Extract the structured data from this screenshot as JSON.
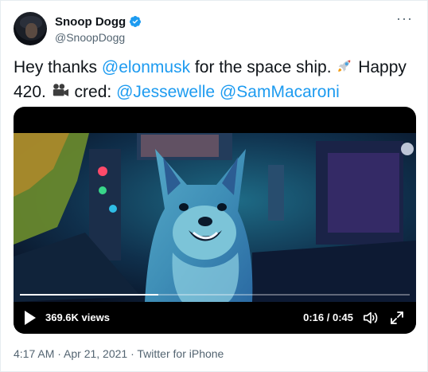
{
  "author": {
    "name": "Snoop Dogg",
    "handle": "@SnoopDogg",
    "verified": true,
    "avatar_icon": "profile-photo"
  },
  "more_icon": "ellipsis-icon",
  "tweet": {
    "segments": [
      {
        "type": "text",
        "value": "Hey thanks "
      },
      {
        "type": "mention",
        "value": "@elonmusk"
      },
      {
        "type": "text",
        "value": " for the space ship. "
      },
      {
        "type": "emoji",
        "value": "rocket-emoji"
      },
      {
        "type": "text",
        "value": " Happy 420. "
      },
      {
        "type": "emoji",
        "value": "movie-camera-emoji"
      },
      {
        "type": "text",
        "value": " cred: "
      },
      {
        "type": "mention",
        "value": "@Jessewelle"
      },
      {
        "type": "text",
        "value": " "
      },
      {
        "type": "mention",
        "value": "@SamMacaroni"
      }
    ]
  },
  "video": {
    "views": "369.6K views",
    "time": "0:16 / 0:45",
    "progress": 0.356,
    "controls": [
      "play-icon",
      "volume-icon",
      "fullscreen-icon"
    ]
  },
  "footer": {
    "meta": "4:17 AM · Apr 21, 2021 · Twitter for iPhone"
  },
  "colors": {
    "link": "#1d9bf0",
    "verified": "#1d9bf0",
    "secondary_text": "#536471"
  }
}
